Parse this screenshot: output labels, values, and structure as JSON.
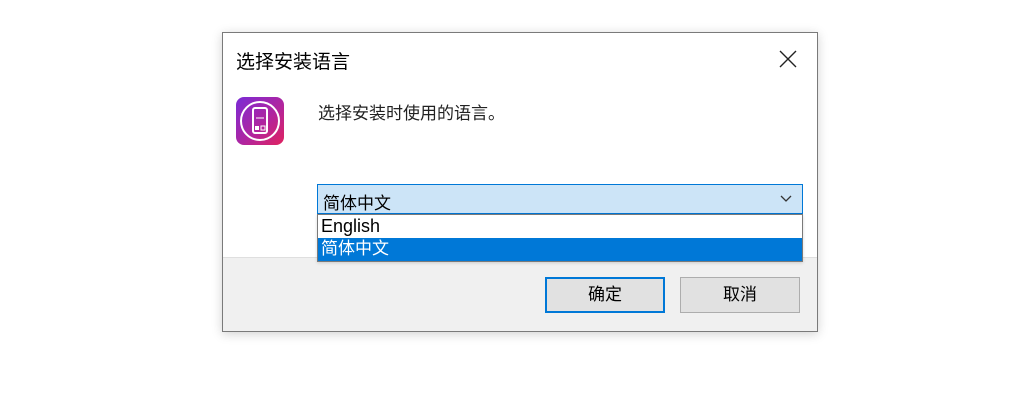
{
  "dialog": {
    "title": "选择安装语言",
    "prompt": "选择安装时使用的语言。",
    "language_select": {
      "selected": "简体中文",
      "options": [
        "English",
        "简体中文"
      ]
    },
    "buttons": {
      "ok": "确定",
      "cancel": "取消"
    }
  },
  "icons": {
    "close": "close-icon",
    "app": "app-icon",
    "dropdown": "chevron-down-icon"
  },
  "colors": {
    "accent": "#0078d7",
    "select_bg": "#cce4f7",
    "footer_bg": "#f0f0f0"
  }
}
